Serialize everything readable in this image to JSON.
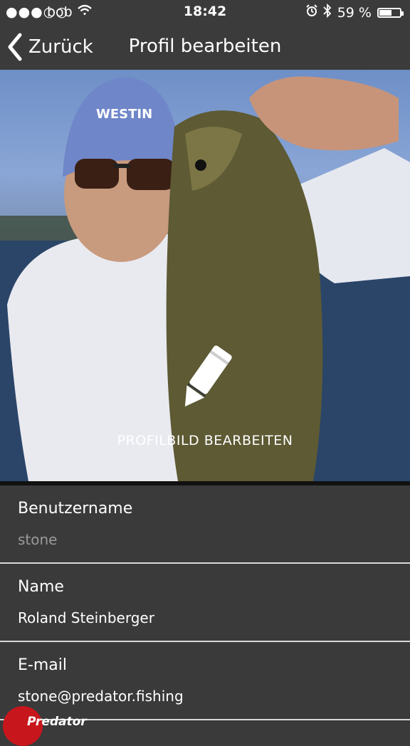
{
  "status_bar": {
    "signal": "●●●○○",
    "carrier": "bob",
    "time": "18:42",
    "battery_percent": "59 %",
    "battery_level": 0.59,
    "icons": [
      "wifi-icon",
      "alarm-icon",
      "bluetooth-icon",
      "battery-icon"
    ]
  },
  "nav": {
    "back_label": "Zurück",
    "title": "Profil bearbeiten"
  },
  "profile_image": {
    "edit_label": "PROFILBILD BEARBEITEN",
    "icon": "pencil-icon"
  },
  "fields": [
    {
      "label": "Benutzername",
      "value": "stone"
    },
    {
      "label": "Name",
      "value": "Roland Steinberger"
    },
    {
      "label": "E-mail",
      "value": "stone@predator.fishing"
    }
  ],
  "logo": {
    "text": "Predator"
  },
  "colors": {
    "background": "#3a3a3a",
    "bar": "#3b3b3b",
    "divider": "#d9d9d9",
    "muted_text": "#9a9a9a",
    "logo_red": "#c8161d"
  }
}
